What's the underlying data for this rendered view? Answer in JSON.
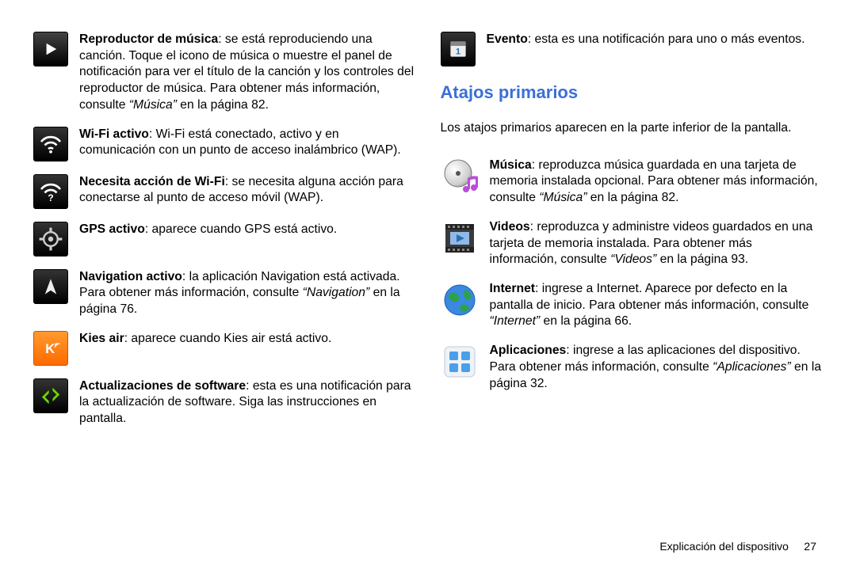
{
  "left_items": [
    {
      "bold": "Reproductor de música",
      "rest": ": se está reproduciendo una canción. Toque el icono de música o muestre el panel de notificación para ver el título de la canción y los controles del reproductor de música. Para obtener más información, consulte ",
      "italic": "“Música”",
      "rest2": " en la página 82."
    },
    {
      "bold": "Wi-Fi activo",
      "rest": ": Wi-Fi está conectado, activo y en comunicación con un punto de acceso inalámbrico (WAP)."
    },
    {
      "bold": "Necesita acción de Wi-Fi",
      "rest": ": se necesita alguna acción para conectarse al punto de acceso móvil (WAP)."
    },
    {
      "bold": "GPS activo",
      "rest": ": aparece cuando GPS está activo."
    },
    {
      "bold": "Navigation activo",
      "rest": ": la aplicación Navigation está activada. Para obtener más información, consulte ",
      "italic": "“Navigation”",
      "rest2": " en la página 76."
    },
    {
      "bold": "Kies air",
      "rest": ": aparece cuando Kies air está activo."
    },
    {
      "bold": "Actualizaciones de software",
      "rest": ": esta es una notificación para la actualización de software. Siga las instrucciones en pantalla."
    }
  ],
  "right_top": {
    "bold": "Evento",
    "rest": ": esta es una notificación para uno o más eventos."
  },
  "heading": "Atajos primarios",
  "sub": "Los atajos primarios aparecen en la parte inferior de la pantalla.",
  "shortcuts": [
    {
      "bold": "Música",
      "rest": ": reproduzca música guardada en una tarjeta de memoria instalada opcional. Para obtener más información, consulte ",
      "italic": "“Música”",
      "rest2": " en la página 82."
    },
    {
      "bold": "Videos",
      "rest": ": reproduzca y administre videos guardados en una tarjeta de memoria instalada. Para obtener más información, consulte ",
      "italic": "“Videos”",
      "rest2": " en la página 93."
    },
    {
      "bold": "Internet",
      "rest": ": ingrese a Internet. Aparece por defecto en la pantalla de inicio. Para obtener más información, consulte ",
      "italic": "“Internet”",
      "rest2": " en la página 66."
    },
    {
      "bold": "Aplicaciones",
      "rest": ": ingrese a las aplicaciones del dispositivo. Para obtener más información, consulte ",
      "italic": "“Aplicaciones”",
      "rest2": " en la página 32."
    }
  ],
  "footer_text": "Explicación del dispositivo",
  "footer_page": "27"
}
